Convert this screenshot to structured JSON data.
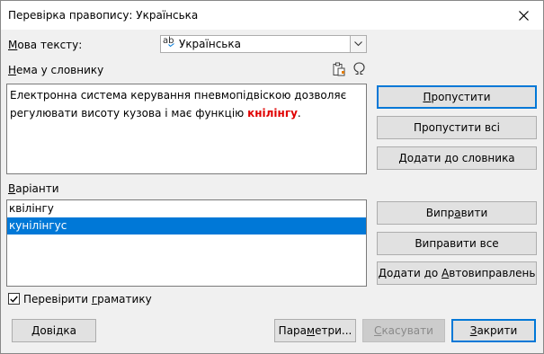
{
  "window": {
    "title": "Перевірка правопису: Українська",
    "close_icon": "close-icon"
  },
  "language": {
    "label": "Мова тексту:",
    "value": "Українська",
    "icon": "spellcheck-ab-icon"
  },
  "not_in_dictionary": {
    "label": "Нема у словнику",
    "text_before": "Електронна система керування пневмопідвіскою дозволяє регулювати висоту кузова і має функцію ",
    "error_word": "кнілінгу",
    "text_after": ".",
    "error_color": "#e00000",
    "icons": [
      "paste-icon",
      "special-character-icon"
    ]
  },
  "suggestions": {
    "label": "Варіанти",
    "items": [
      "квілінгу",
      "кунілінгус"
    ],
    "selected": "кунілінгус",
    "selection_color": "#0078d7"
  },
  "side_buttons": {
    "ignore": "Пропустити",
    "ignore_all": "Пропустити всі",
    "add_to_dictionary": "Додати до словника",
    "correct": "Виправити",
    "correct_all": "Виправити все",
    "add_to_autocorrect": "Додати до Автовиправлень"
  },
  "check_grammar": {
    "label": "Перевірити граматику",
    "checked": true
  },
  "footer": {
    "help": "Довідка",
    "options": "Параметри...",
    "undo": "Скасувати",
    "close": "Закрити"
  },
  "colors": {
    "accent": "#0078d7",
    "dialog_bg": "#f0f0f0",
    "button_bg": "#e1e1e1"
  }
}
